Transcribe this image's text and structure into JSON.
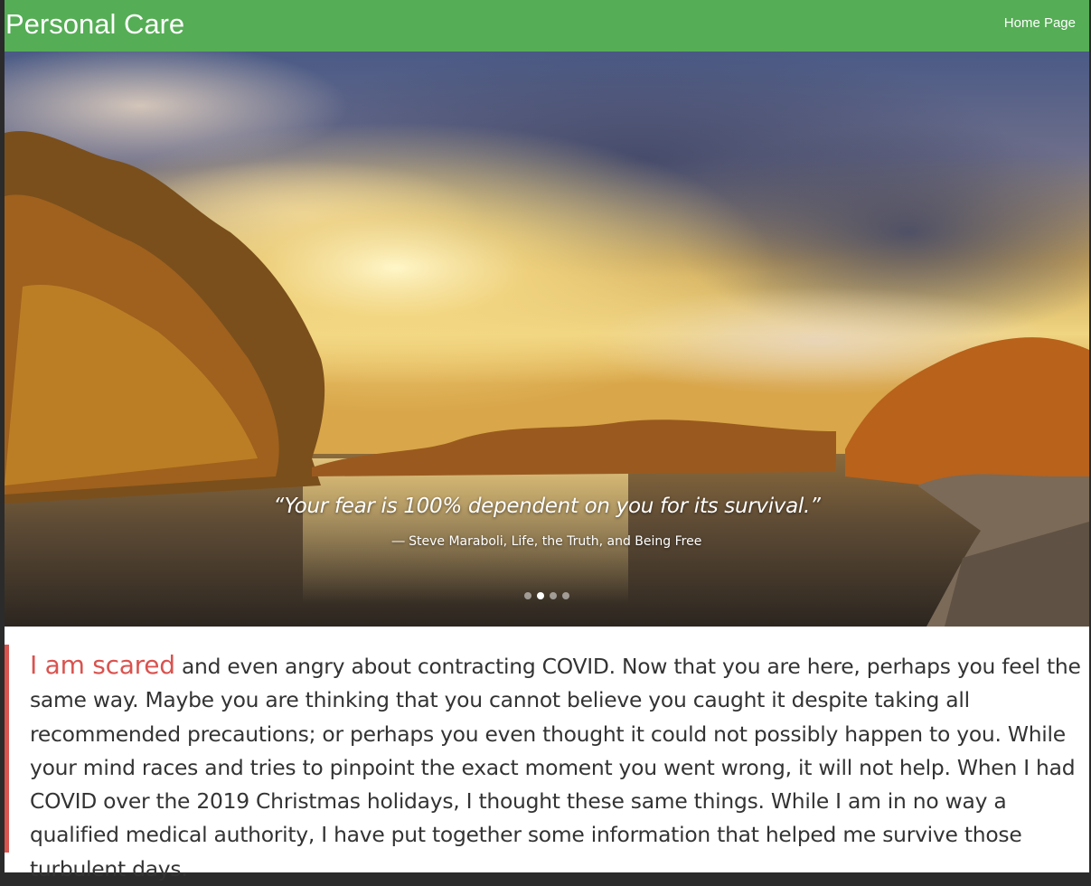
{
  "navbar": {
    "brand": "Personal Care",
    "home_link": "Home Page"
  },
  "carousel": {
    "quote": "“Your fear is 100% dependent on you for its survival.”",
    "author": "― Steve Maraboli, Life, the Truth, and Being Free",
    "slide_count": 4,
    "active_slide": 2
  },
  "intro": {
    "highlight": "I am scared",
    "text": " and even angry about contracting COVID. Now that you are here, perhaps you feel the same way. Maybe you are thinking that you cannot believe you caught it despite taking all recommended precautions; or perhaps you even thought it could not possibly happen to you. While your mind races and tries to pinpoint the exact moment you went wrong, it will not help. When I had COVID over the 2019 Christmas holidays, I thought these same things. While I am in no way a qualified medical authority, I have put together some information that helped me survive those turbulent days."
  },
  "colors": {
    "navbar": "#55ad55",
    "accent": "#d9534f",
    "text": "#333333"
  }
}
